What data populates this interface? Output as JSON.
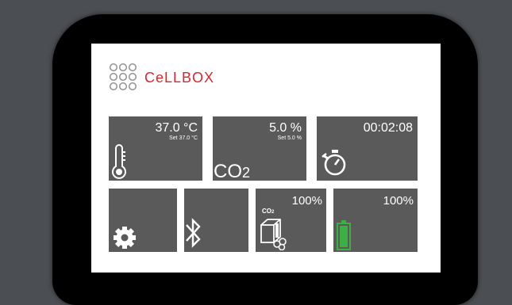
{
  "brand": {
    "name": "CeLLBOX",
    "color": "#d4272e"
  },
  "colors": {
    "tile": "#5a5a5a",
    "battery": "#3cb043",
    "screen": "#ffffff",
    "bezel": "#000000"
  },
  "temperature": {
    "value": "37.0 °C",
    "setpoint": "Set 37.0 °C",
    "icon": "thermometer-icon"
  },
  "co2": {
    "value": "5.0 %",
    "setpoint": "Set 5.0 %",
    "label_main": "CO",
    "label_sub": "2"
  },
  "timer": {
    "value": "00:02:08",
    "icon": "stopwatch-icon"
  },
  "settings": {
    "icon": "gear-icon"
  },
  "bluetooth": {
    "icon": "bluetooth-icon"
  },
  "co2_supply": {
    "percent": "100%",
    "icon_label": "CO",
    "icon_label_sub": "2",
    "icon": "co2-cartridge-icon"
  },
  "battery": {
    "percent": "100%",
    "level": 1.0,
    "icon": "battery-icon"
  }
}
